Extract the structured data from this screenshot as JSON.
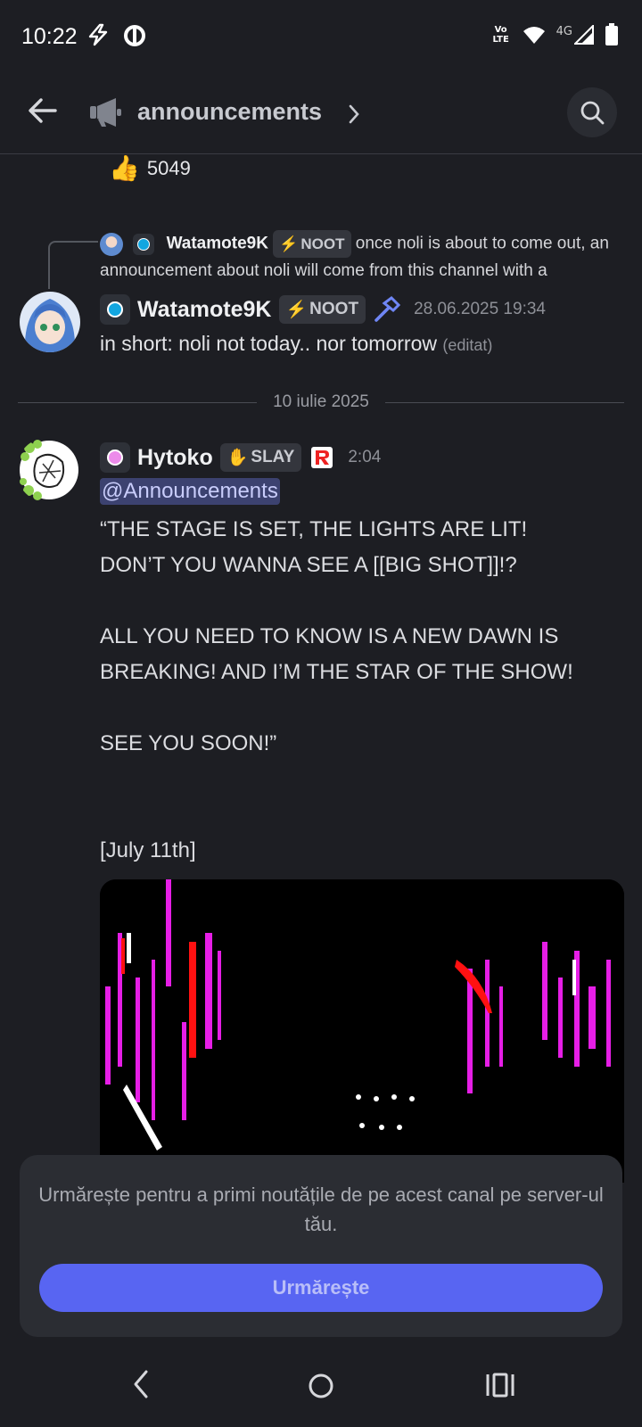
{
  "status_bar": {
    "time": "10:22",
    "network": "4G",
    "volte": "Vo LTE"
  },
  "header": {
    "channel_name": "announcements"
  },
  "reaction": {
    "emoji": "👍",
    "count": "5049"
  },
  "reply_preview": {
    "username": "Watamote9K",
    "tag": "NOOT",
    "text": "once noli is about to come out, an announcement about noli will come from this channel with a"
  },
  "message1": {
    "username": "Watamote9K",
    "tag": "NOOT",
    "timestamp": "28.06.2025 19:34",
    "text": "in short: noli not today.. nor tomorrow",
    "edited_label": "(editat)"
  },
  "date_divider": "10 iulie 2025",
  "message2": {
    "username": "Hytoko",
    "tag": "SLAY",
    "timestamp": "2:04",
    "mention": "@Announcements",
    "body": "“THE STAGE IS SET, THE LIGHTS ARE LIT!\nDON’T YOU WANNA SEE A [[BIG SHOT]]!?\n\nALL YOU NEED TO KNOW IS A NEW DAWN IS BREAKING! AND I’M THE STAR OF THE SHOW!\n\nSEE YOU SOON!”\n\n\n[July 11th]"
  },
  "follow_card": {
    "text": "Urmărește pentru a primi noutățile de pe acest canal pe server-ul tău.",
    "button_label": "Urmărește"
  },
  "colors": {
    "accent": "#5865f2",
    "background": "#1d1e23",
    "card": "#2b2d33"
  }
}
